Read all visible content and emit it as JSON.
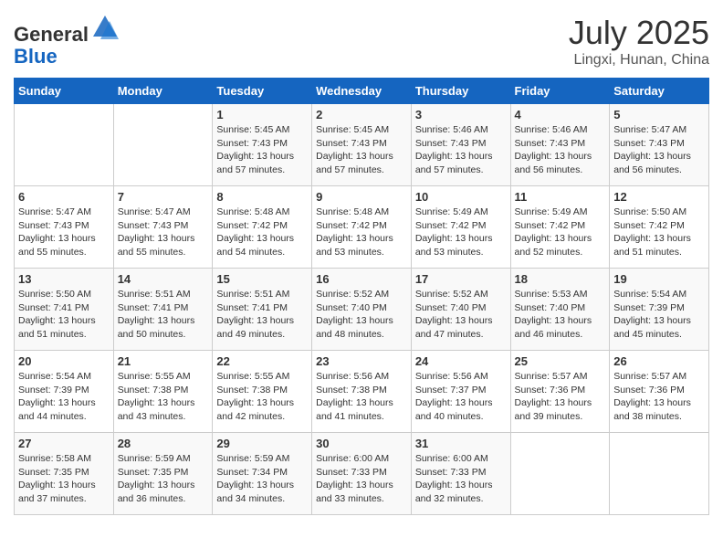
{
  "header": {
    "logo_general": "General",
    "logo_blue": "Blue",
    "month": "July 2025",
    "location": "Lingxi, Hunan, China"
  },
  "weekdays": [
    "Sunday",
    "Monday",
    "Tuesday",
    "Wednesday",
    "Thursday",
    "Friday",
    "Saturday"
  ],
  "weeks": [
    [
      {
        "day": "",
        "info": ""
      },
      {
        "day": "",
        "info": ""
      },
      {
        "day": "1",
        "info": "Sunrise: 5:45 AM\nSunset: 7:43 PM\nDaylight: 13 hours and 57 minutes."
      },
      {
        "day": "2",
        "info": "Sunrise: 5:45 AM\nSunset: 7:43 PM\nDaylight: 13 hours and 57 minutes."
      },
      {
        "day": "3",
        "info": "Sunrise: 5:46 AM\nSunset: 7:43 PM\nDaylight: 13 hours and 57 minutes."
      },
      {
        "day": "4",
        "info": "Sunrise: 5:46 AM\nSunset: 7:43 PM\nDaylight: 13 hours and 56 minutes."
      },
      {
        "day": "5",
        "info": "Sunrise: 5:47 AM\nSunset: 7:43 PM\nDaylight: 13 hours and 56 minutes."
      }
    ],
    [
      {
        "day": "6",
        "info": "Sunrise: 5:47 AM\nSunset: 7:43 PM\nDaylight: 13 hours and 55 minutes."
      },
      {
        "day": "7",
        "info": "Sunrise: 5:47 AM\nSunset: 7:43 PM\nDaylight: 13 hours and 55 minutes."
      },
      {
        "day": "8",
        "info": "Sunrise: 5:48 AM\nSunset: 7:42 PM\nDaylight: 13 hours and 54 minutes."
      },
      {
        "day": "9",
        "info": "Sunrise: 5:48 AM\nSunset: 7:42 PM\nDaylight: 13 hours and 53 minutes."
      },
      {
        "day": "10",
        "info": "Sunrise: 5:49 AM\nSunset: 7:42 PM\nDaylight: 13 hours and 53 minutes."
      },
      {
        "day": "11",
        "info": "Sunrise: 5:49 AM\nSunset: 7:42 PM\nDaylight: 13 hours and 52 minutes."
      },
      {
        "day": "12",
        "info": "Sunrise: 5:50 AM\nSunset: 7:42 PM\nDaylight: 13 hours and 51 minutes."
      }
    ],
    [
      {
        "day": "13",
        "info": "Sunrise: 5:50 AM\nSunset: 7:41 PM\nDaylight: 13 hours and 51 minutes."
      },
      {
        "day": "14",
        "info": "Sunrise: 5:51 AM\nSunset: 7:41 PM\nDaylight: 13 hours and 50 minutes."
      },
      {
        "day": "15",
        "info": "Sunrise: 5:51 AM\nSunset: 7:41 PM\nDaylight: 13 hours and 49 minutes."
      },
      {
        "day": "16",
        "info": "Sunrise: 5:52 AM\nSunset: 7:40 PM\nDaylight: 13 hours and 48 minutes."
      },
      {
        "day": "17",
        "info": "Sunrise: 5:52 AM\nSunset: 7:40 PM\nDaylight: 13 hours and 47 minutes."
      },
      {
        "day": "18",
        "info": "Sunrise: 5:53 AM\nSunset: 7:40 PM\nDaylight: 13 hours and 46 minutes."
      },
      {
        "day": "19",
        "info": "Sunrise: 5:54 AM\nSunset: 7:39 PM\nDaylight: 13 hours and 45 minutes."
      }
    ],
    [
      {
        "day": "20",
        "info": "Sunrise: 5:54 AM\nSunset: 7:39 PM\nDaylight: 13 hours and 44 minutes."
      },
      {
        "day": "21",
        "info": "Sunrise: 5:55 AM\nSunset: 7:38 PM\nDaylight: 13 hours and 43 minutes."
      },
      {
        "day": "22",
        "info": "Sunrise: 5:55 AM\nSunset: 7:38 PM\nDaylight: 13 hours and 42 minutes."
      },
      {
        "day": "23",
        "info": "Sunrise: 5:56 AM\nSunset: 7:38 PM\nDaylight: 13 hours and 41 minutes."
      },
      {
        "day": "24",
        "info": "Sunrise: 5:56 AM\nSunset: 7:37 PM\nDaylight: 13 hours and 40 minutes."
      },
      {
        "day": "25",
        "info": "Sunrise: 5:57 AM\nSunset: 7:36 PM\nDaylight: 13 hours and 39 minutes."
      },
      {
        "day": "26",
        "info": "Sunrise: 5:57 AM\nSunset: 7:36 PM\nDaylight: 13 hours and 38 minutes."
      }
    ],
    [
      {
        "day": "27",
        "info": "Sunrise: 5:58 AM\nSunset: 7:35 PM\nDaylight: 13 hours and 37 minutes."
      },
      {
        "day": "28",
        "info": "Sunrise: 5:59 AM\nSunset: 7:35 PM\nDaylight: 13 hours and 36 minutes."
      },
      {
        "day": "29",
        "info": "Sunrise: 5:59 AM\nSunset: 7:34 PM\nDaylight: 13 hours and 34 minutes."
      },
      {
        "day": "30",
        "info": "Sunrise: 6:00 AM\nSunset: 7:33 PM\nDaylight: 13 hours and 33 minutes."
      },
      {
        "day": "31",
        "info": "Sunrise: 6:00 AM\nSunset: 7:33 PM\nDaylight: 13 hours and 32 minutes."
      },
      {
        "day": "",
        "info": ""
      },
      {
        "day": "",
        "info": ""
      }
    ]
  ]
}
